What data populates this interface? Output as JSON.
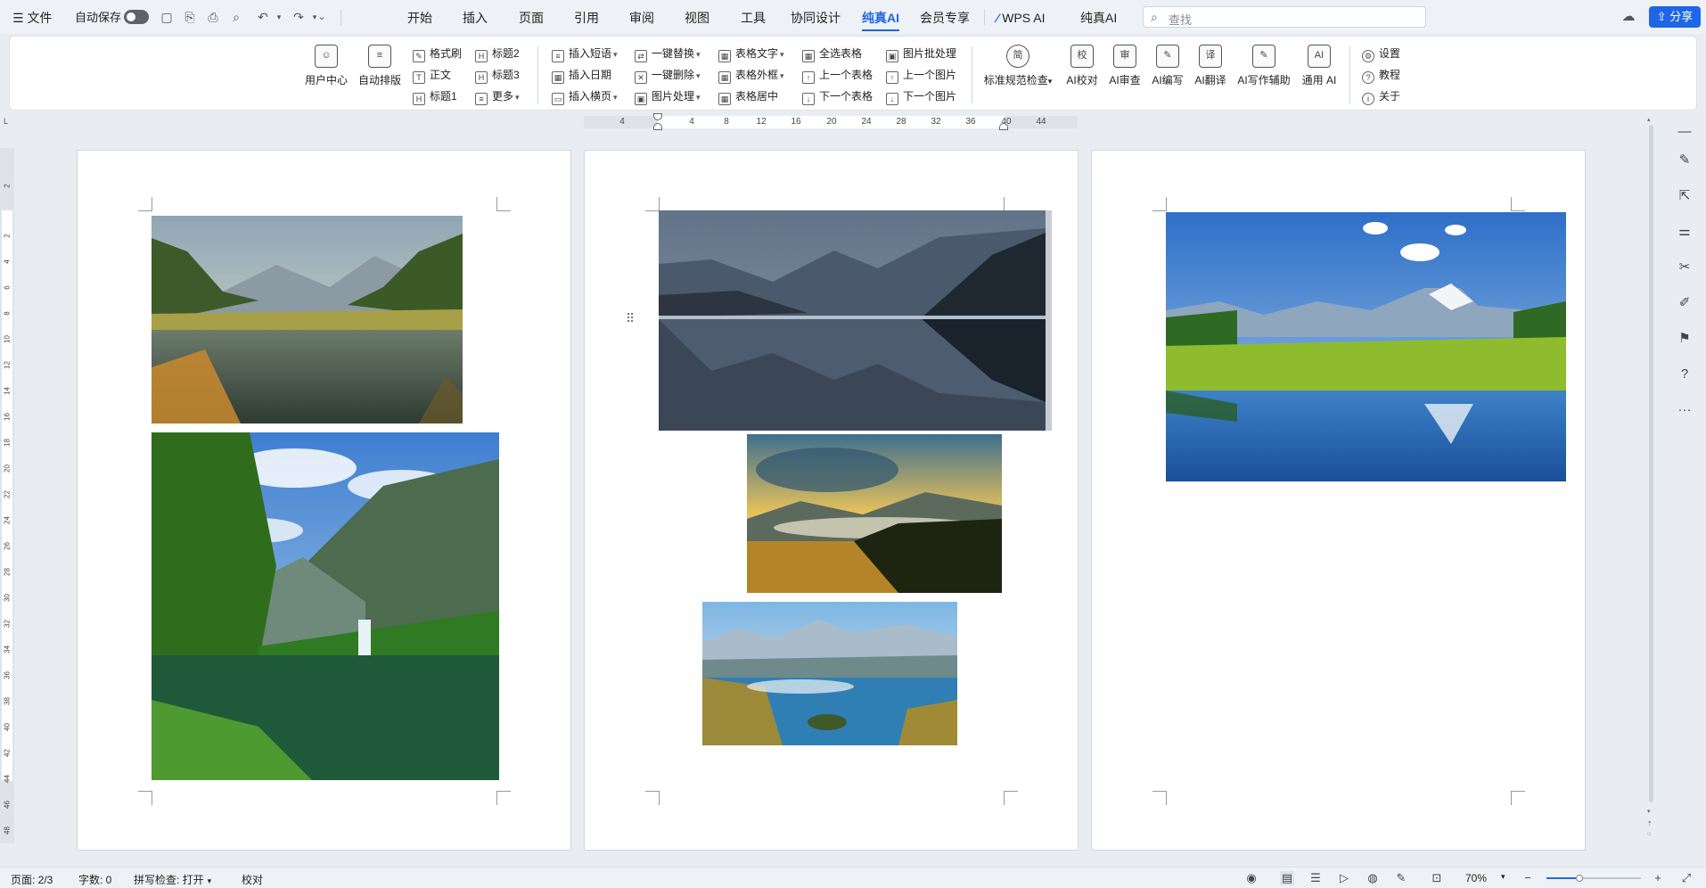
{
  "menubar": {
    "file": "文件",
    "autosave": "自动保存",
    "tabs": [
      "开始",
      "插入",
      "页面",
      "引用",
      "审阅",
      "视图",
      "工具",
      "协同设计",
      "纯真AI",
      "会员专享"
    ],
    "wps_ai": "WPS AI",
    "pure_ai": "纯真AI",
    "search_placeholder": "查找",
    "share": "分享"
  },
  "ribbon": {
    "big1": [
      {
        "label": "用户中心",
        "icon": "user-icon"
      },
      {
        "label": "自动排版",
        "icon": "format-icon"
      }
    ],
    "col_styles": [
      "格式刷",
      "正文",
      "标题1"
    ],
    "col_headings": [
      "标题2",
      "标题3",
      "更多"
    ],
    "col_insert": [
      "插入短语",
      "插入日期",
      "插入横页"
    ],
    "col_edit": [
      "一键替换",
      "一键删除",
      "图片处理"
    ],
    "col_table": [
      "表格文字",
      "表格外框",
      "表格居中"
    ],
    "col_select": [
      "全选表格",
      "上一个表格",
      "下一个表格"
    ],
    "col_pic": [
      "图片批处理",
      "上一个图片",
      "下一个图片"
    ],
    "big2": [
      {
        "label": "标准规范检查",
        "glyph": "简"
      },
      {
        "label": "AI校对",
        "glyph": "校"
      },
      {
        "label": "AI审查",
        "glyph": "审"
      },
      {
        "label": "AI编写",
        "glyph": "✎"
      },
      {
        "label": "AI翻译",
        "glyph": "译"
      },
      {
        "label": "AI写作辅助",
        "glyph": "✎"
      },
      {
        "label": "通用 AI",
        "glyph": "AI"
      }
    ],
    "col_settings": [
      "设置",
      "教程",
      "关于"
    ]
  },
  "ruler": {
    "h": [
      "4",
      "4",
      "8",
      "12",
      "16",
      "20",
      "24",
      "28",
      "32",
      "36",
      "40",
      "44"
    ],
    "v": [
      "2",
      "2",
      "4",
      "6",
      "8",
      "10",
      "12",
      "14",
      "16",
      "18",
      "20",
      "22",
      "24",
      "26",
      "28",
      "30",
      "32",
      "34",
      "36",
      "38",
      "40",
      "42",
      "44",
      "46",
      "48"
    ]
  },
  "status": {
    "page": "页面: 2/3",
    "words": "字数: 0",
    "spell": "拼写检查: 打开",
    "proof": "校对",
    "zoom": "70%",
    "zoom_level": 0.35
  },
  "colors": {
    "accent": "#1e66e6",
    "page_bg": "#e9edf2"
  }
}
